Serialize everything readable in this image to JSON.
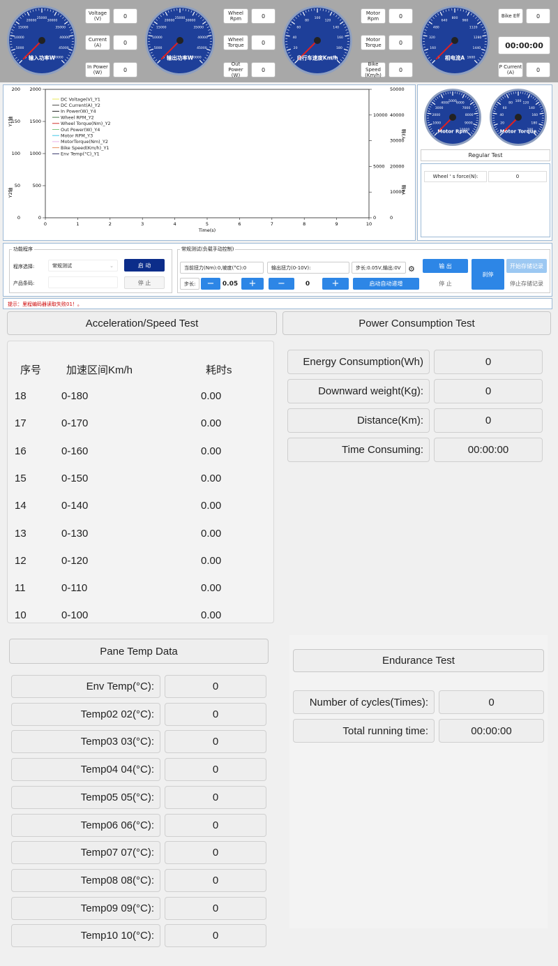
{
  "gauges": [
    {
      "label": "输入功率W",
      "ticks": [
        "0",
        "5000",
        "10000",
        "15000",
        "20000",
        "25000",
        "30000",
        "35000",
        "40000",
        "45000",
        "50000"
      ],
      "fields": [
        {
          "label": "Voltage\n(V)",
          "value": "0"
        },
        {
          "label": "Current\n(A)",
          "value": "0"
        },
        {
          "label": "In Power\n(W)",
          "value": "0"
        }
      ]
    },
    {
      "label": "输出功率W",
      "ticks": [
        "0",
        "5000",
        "10000",
        "15000",
        "20000",
        "25000",
        "30000",
        "35000",
        "40000",
        "45000",
        "50000"
      ],
      "fields": [
        {
          "label": "Wheel\nRpm",
          "value": "0"
        },
        {
          "label": "Wheel\nTorque",
          "value": "0"
        },
        {
          "label": "Out Power\n(W)",
          "value": "0"
        }
      ]
    },
    {
      "label": "自行车速度Km/h",
      "ticks": [
        "0",
        "20",
        "40",
        "60",
        "80",
        "100",
        "120",
        "140",
        "160",
        "180",
        "200"
      ],
      "fields": [
        {
          "label": "Motor\nRpm",
          "value": "0"
        },
        {
          "label": "Motor\nTorque",
          "value": "0"
        },
        {
          "label": "Bike Speed\n(Km/h)",
          "value": "0"
        }
      ]
    },
    {
      "label": "相电流A",
      "ticks": [
        "0",
        "160",
        "320",
        "480",
        "640",
        "800",
        "960",
        "1120",
        "1280",
        "1440",
        "1600"
      ],
      "fields": [
        {
          "label": "Bike Eff",
          "value": "0"
        },
        {
          "label": "",
          "value": "00:00:00"
        },
        {
          "label": "P Current\n(A)",
          "value": "0"
        }
      ]
    }
  ],
  "chart_data": {
    "type": "line",
    "xlabel": "Time(s)",
    "x_ticks": [
      "0",
      "1",
      "2",
      "3",
      "4",
      "5",
      "6",
      "7",
      "8",
      "9",
      "10"
    ],
    "y1_label": "Y1轴",
    "y1_ticks": [
      "0",
      "50",
      "100",
      "150",
      "200"
    ],
    "y2_label": "Y2轴",
    "y2_ticks": [
      "0",
      "500",
      "1000",
      "1500",
      "2000"
    ],
    "y3_label": "Y3轴",
    "y3_ticks": [
      "0",
      "10000",
      "20000",
      "30000",
      "40000",
      "50000"
    ],
    "y4_label": "Y4轴",
    "y4_ticks": [
      "0",
      "5000",
      "10000"
    ],
    "xlim": [
      0,
      10
    ],
    "y1lim": [
      0,
      200
    ],
    "y2lim": [
      0,
      2000
    ],
    "y3lim": [
      0,
      50000
    ],
    "y4lim": [
      0,
      12500
    ],
    "legend_position": "top-left",
    "series": [
      {
        "name": "DC Voltage(V)_Y1",
        "color": "#e8e85a",
        "values": []
      },
      {
        "name": "DC Current(A)_Y2",
        "color": "#444444",
        "values": []
      },
      {
        "name": "In Power(W)_Y4",
        "color": "#222222",
        "values": []
      },
      {
        "name": "Wheel RPM_Y2",
        "color": "#4a7a4a",
        "values": []
      },
      {
        "name": "Wheel Torque(Nm)_Y2",
        "color": "#d0302a",
        "values": []
      },
      {
        "name": "Out Power(W)_Y4",
        "color": "#7fc37f",
        "values": []
      },
      {
        "name": "Motor RPM_Y3",
        "color": "#44c8e8",
        "values": []
      },
      {
        "name": "MotorTorque(Nm)_Y2",
        "color": "#e8b0e8",
        "values": []
      },
      {
        "name": "Bike Speed(Km/h)_Y1",
        "color": "#e89060",
        "values": []
      },
      {
        "name": "Env Temp(°C)_Y1",
        "color": "#333366",
        "values": []
      }
    ]
  },
  "right_panel": {
    "gauge1": {
      "label": "Motor Rpm",
      "ticks": [
        "0",
        "1000",
        "2000",
        "3000",
        "4000",
        "5000",
        "6000",
        "7000",
        "8000",
        "9000",
        "10000"
      ]
    },
    "gauge2": {
      "label": "Motor Torque",
      "ticks": [
        "0",
        "20",
        "40",
        "60",
        "80",
        "100",
        "120",
        "140",
        "160",
        "180",
        "200"
      ]
    },
    "regular_test": "Regular Test",
    "wheel_force_label": "Wheel ' s force(N):",
    "wheel_force_value": "0"
  },
  "controls": {
    "group1_title": "功能程序",
    "program_label": "程序选择:",
    "program_value": "常规测试",
    "barcode_label": "产品条码:",
    "start_button": "启 动",
    "stop_button": "停 止",
    "group2_title": "常规测试(负载手动控制)",
    "current_torque": "当前扭力(Nm):0,坡度(°C):0",
    "output_torque": "输出扭力(0-10V):",
    "step_info": "步长:0.05V,输出:0V",
    "step_label": "步长:",
    "step_value": "0.05",
    "torque_value": "0",
    "auto_increase": "启动自动递增",
    "output_button": "输 出",
    "stop2_button": "停 止",
    "brake_button": "刹停",
    "start_record": "开始存储记录",
    "stop_record": "停止存储记录",
    "minus": "−",
    "plus": "+"
  },
  "hint_text": "提示：里程编码器读取失败01！。",
  "acceleration": {
    "title": "Acceleration/Speed Test",
    "headers": [
      "序号",
      "加速区间Km/h",
      "耗时s"
    ],
    "rows": [
      [
        "18",
        "0-180",
        "0.00"
      ],
      [
        "17",
        "0-170",
        "0.00"
      ],
      [
        "16",
        "0-160",
        "0.00"
      ],
      [
        "15",
        "0-150",
        "0.00"
      ],
      [
        "14",
        "0-140",
        "0.00"
      ],
      [
        "13",
        "0-130",
        "0.00"
      ],
      [
        "12",
        "0-120",
        "0.00"
      ],
      [
        "11",
        "0-110",
        "0.00"
      ],
      [
        "10",
        "0-100",
        "0.00"
      ]
    ]
  },
  "power": {
    "title": "Power Consumption Test",
    "rows": [
      {
        "label": "Energy Consumption(Wh)",
        "value": "0"
      },
      {
        "label": "Downward weight(Kg):",
        "value": "0"
      },
      {
        "label": "Distance(Km):",
        "value": "0"
      },
      {
        "label": "Time Consuming:",
        "value": "00:00:00"
      }
    ]
  },
  "pane_temp": {
    "title": "Pane Temp Data",
    "rows": [
      {
        "label": "Env Temp(°C):",
        "value": "0"
      },
      {
        "label": "Temp02 02(°C):",
        "value": "0"
      },
      {
        "label": "Temp03 03(°C):",
        "value": "0"
      },
      {
        "label": "Temp04 04(°C):",
        "value": "0"
      },
      {
        "label": "Temp05 05(°C):",
        "value": "0"
      },
      {
        "label": "Temp06 06(°C):",
        "value": "0"
      },
      {
        "label": "Temp07 07(°C):",
        "value": "0"
      },
      {
        "label": "Temp08 08(°C):",
        "value": "0"
      },
      {
        "label": "Temp09 09(°C):",
        "value": "0"
      },
      {
        "label": "Temp10 10(°C):",
        "value": "0"
      }
    ]
  },
  "endurance": {
    "title": "Endurance Test",
    "rows": [
      {
        "label": "Number of cycles(Times):",
        "value": "0"
      },
      {
        "label": "Total running time:",
        "value": "00:00:00"
      }
    ]
  },
  "colors": {
    "gauge_face": "#1e3f99",
    "gauge_rim": "#8fa0c0",
    "needle": "#e02020",
    "strip": "#a8a8a8",
    "border": "#9cb9d6",
    "accent": "#2d86e6",
    "start_btn": "#0c2d8a"
  }
}
